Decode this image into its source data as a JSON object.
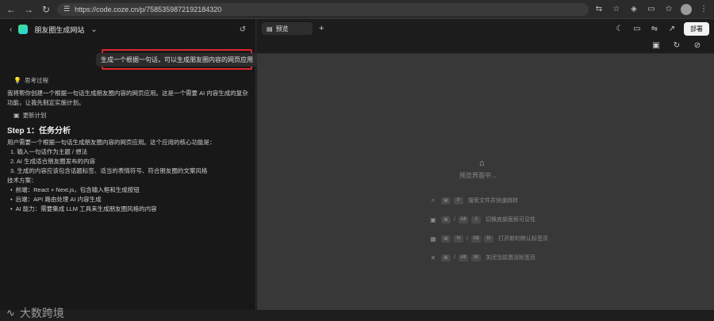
{
  "browser": {
    "url": "https://code.coze.cn/p/7585359872192184320"
  },
  "left_panel": {
    "app_name": "朋友圈生成网站",
    "user_message": "生成一个根据一句话，可以生成朋友圈内容的网页应用",
    "thinking_label": "思考过程",
    "intro": "我将帮你创建一个根据一句话生成朋友圈内容的网页应用。这是一个需要 AI 内容生成的复杂功能，让我先制定实施计划。",
    "plan_label": "更新计划",
    "step_title": "Step 1：任务分析",
    "step_desc": "用户需要一个根据一句话生成朋友圈内容的网页应用。这个应用的核心功能是：",
    "features": [
      "1. 输入一句话作为主题 / 想法",
      "2. AI 生成适合朋友圈发布的内容",
      "3. 生成的内容应该包含话题标签、适当的表情符号、符合朋友圈的文案风格"
    ],
    "tech_label": "技术方案：",
    "tech_items": [
      "前端：React + Next.js，包含输入框和生成按钮",
      "后端：API 路由处理 AI 内容生成",
      "AI 能力：需要集成 LLM 工具来生成朋友圈风格的内容"
    ],
    "watermark": "大数跨境"
  },
  "right_panel": {
    "tab_label": "预览",
    "deploy_label": "部署",
    "loading_text": "预览界面中...",
    "shortcuts": [
      {
        "icon": "search-icon",
        "keys": [
          "⌘",
          "P"
        ],
        "label": "搜索文件并快速跳转"
      },
      {
        "icon": "terminal-icon",
        "keys": [
          "⌘",
          "/",
          "Alt",
          "J"
        ],
        "label": "切换底部面板可见性"
      },
      {
        "icon": "calendar-icon",
        "keys": [
          "⌘",
          "N",
          "/",
          "Alt",
          "N"
        ],
        "label": "打开新的默认标签页"
      },
      {
        "icon": "close-icon",
        "keys": [
          "⌘",
          "/",
          "Alt",
          "W"
        ],
        "label": "关闭当前激活标签页"
      }
    ]
  },
  "colors": {
    "highlight_border": "#e0262d",
    "preview_bg": "#383838",
    "chat_bg": "#181818"
  }
}
